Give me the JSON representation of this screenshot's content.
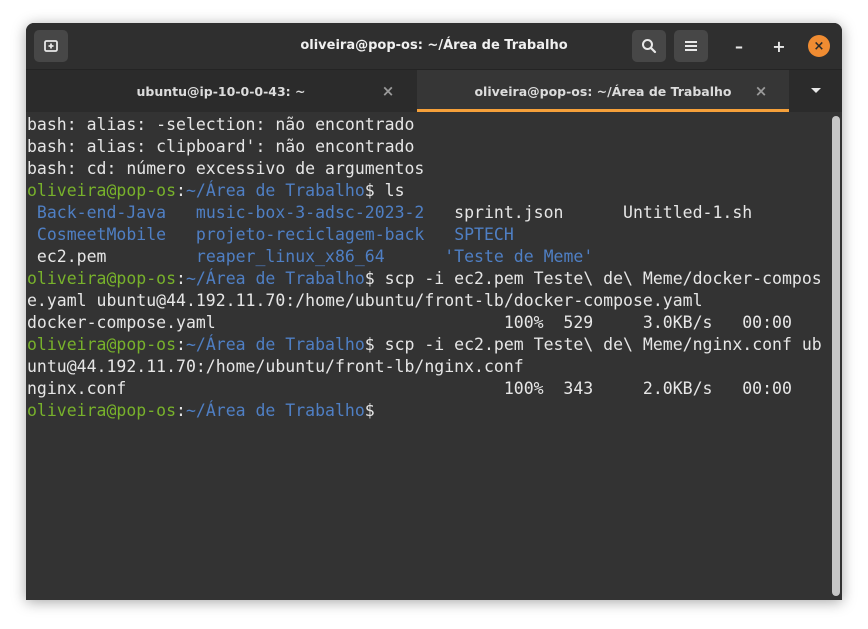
{
  "window": {
    "title": "oliveira@pop-os: ~/Área de Trabalho",
    "new_tab_icon": "new-tab-icon",
    "search_icon": "search-icon",
    "menu_icon": "hamburger-menu-icon",
    "minimize_label": "–",
    "maximize_label": "+",
    "close_label": "×"
  },
  "tabs": [
    {
      "label": "ubuntu@ip-10-0-0-43: ~",
      "close": "×",
      "active": false
    },
    {
      "label": "oliveira@pop-os: ~/Área de Trabalho",
      "close": "×",
      "active": true
    }
  ],
  "colors": {
    "accent": "#f5a03a",
    "prompt_user": "#78b22b",
    "directory": "#4f7fc4",
    "background": "#333333"
  },
  "terminal": {
    "prompt_user": "oliveira@pop-os",
    "prompt_sep": ":",
    "prompt_path": "~/Área de Trabalho",
    "prompt_end": "$",
    "line1": "bash: alias: -selection: não encontrado",
    "line2": "bash: alias: clipboard': não encontrado",
    "line3": "bash: cd: número excessivo de argumentos",
    "cmd1": " ls",
    "ls_row1": [
      " Back-end-Java   ",
      "music-box-3-adsc-2023-2",
      "   sprint.json      Untitled-1.sh"
    ],
    "ls_row2": [
      " CosmeetMobile   ",
      "projeto-reciclagem-back",
      "   ",
      "SPTECH"
    ],
    "ls_row3": [
      " ec2.pem         ",
      "reaper_linux_x86_64",
      "      ",
      "'Teste de Meme'"
    ],
    "cmd2": " scp -i ec2.pem Teste\\ de\\ Meme/docker-compos",
    "cmd2_cont": "e.yaml ubuntu@44.192.11.70:/home/ubuntu/front-lb/docker-compose.yaml",
    "out2": "docker-compose.yaml                             100%  529     3.0KB/s   00:00",
    "cmd3": " scp -i ec2.pem Teste\\ de\\ Meme/nginx.conf ub",
    "cmd3_cont": "untu@44.192.11.70:/home/ubuntu/front-lb/nginx.conf",
    "out3": "nginx.conf                                      100%  343     2.0KB/s   00:00"
  }
}
